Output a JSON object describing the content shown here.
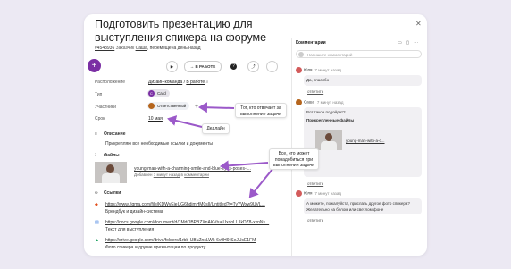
{
  "task": {
    "title": "Подготовить презентацию для выступления спикера на форуме",
    "id": "#4543936",
    "customer_label": "Заказчик",
    "customer": "Саша",
    "moved_note": ", перемещена день назад"
  },
  "toolbar": {
    "play": "▶",
    "status": "В РАБОТЕ",
    "add": "+",
    "help": "?",
    "share": "⤴",
    "more": "⋮"
  },
  "fields": {
    "location_label": "Расположение",
    "location_value": "Дизайн-команда",
    "location_sep": "/",
    "location_sub": "В работе",
    "type_label": "Тип",
    "type_value": "Card",
    "participants_label": "Участники",
    "participants_value": "Ответственный",
    "deadline_label": "Срок",
    "deadline_value": "10 мая"
  },
  "description": {
    "title": "Описание",
    "text": "Прикрепляю все необходимые ссылки и документы"
  },
  "files": {
    "title": "Файлы",
    "name": "young-man-with-a-charming-smile-and-blue-eyes-poses-i...",
    "added_prefix": "Добавлен ",
    "added_time": "7 минут назад",
    "added_mid": " в ",
    "added_where": "комментарии"
  },
  "links": {
    "title": "Ссылки",
    "items": [
      {
        "url": "https://www.figma.com/file/KDWvEjeUG6hdjmHM0sIl/Untitled?t=TyYWxw9UVL...",
        "desc": "Брендбук и дизайн-система"
      },
      {
        "url": "https://docs.google.com/document/d/1MdOBPBZXnAKVtueUxdoLL1kDZ8-xxnNs...",
        "desc": "Текст для выступления"
      },
      {
        "url": "https://drive.google.com/drive/folders/1rbb-UBuZnsLWk-6v9H9rSeJUsE1FM",
        "desc": "Фото спикера и другие презентации по продукту"
      }
    ]
  },
  "comments": {
    "title": "Комментарии",
    "placeholder": "Напишите комментарий",
    "reply_label": "ответить",
    "items": [
      {
        "author": "Юля",
        "time": "7 минут назад",
        "text": "Да, спасибо"
      },
      {
        "author": "Саша",
        "time": "7 минут назад",
        "text1": "Вот такое подойдет?",
        "text2": "Прикрепленные файлы",
        "file": "young-man-with-a-c..."
      },
      {
        "author": "Юля",
        "time": "7 минут назад",
        "text": "А можете, пожалуйста, прислать другое фото спикера? Желательно на белом или светлом фоне"
      }
    ]
  },
  "callouts": {
    "responsible": "Тот, кто отвечает за выполнение задачи",
    "deadline": "Дедлайн",
    "everything": "Все, что может понадобиться при выполнении задачи"
  },
  "icons": {
    "close": "close-icon",
    "search": "search-icon",
    "description": "text-lines-icon",
    "files": "paperclip-icon",
    "links": "link-icon",
    "figma": "figma-icon",
    "gdocs": "google-docs-icon",
    "gdrive": "google-drive-icon"
  },
  "colors": {
    "accent": "#7b2fa4",
    "annotation": "#9b59c9",
    "background": "#ece9f3"
  }
}
